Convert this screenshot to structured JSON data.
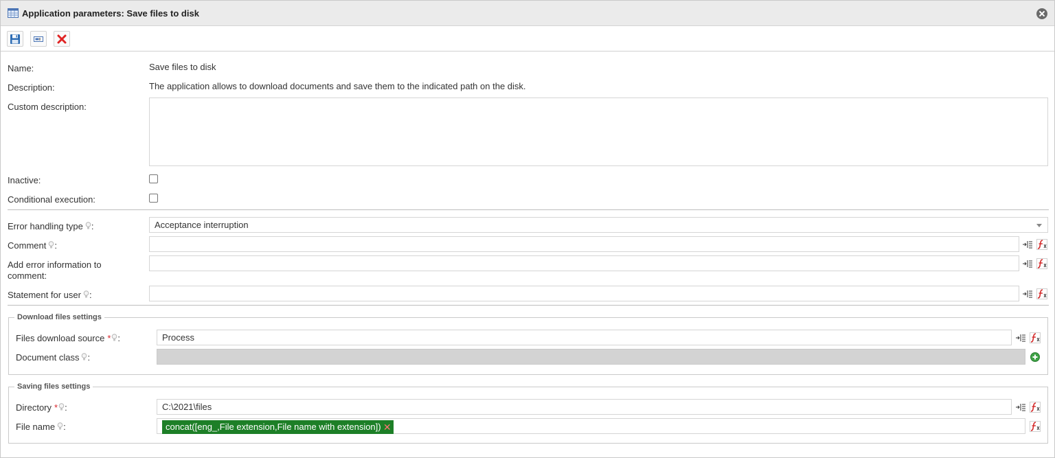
{
  "window": {
    "title": "Application parameters: Save files to disk"
  },
  "icons": {
    "title": "table-icon",
    "close": "close-circle-icon",
    "save": "floppy-disk-icon",
    "form": "form-field-icon",
    "delete": "red-x-icon",
    "hint": "lightbulb-icon",
    "variable": "insert-variable-icon",
    "function": "function-icon",
    "add": "green-plus-circle-icon"
  },
  "colors": {
    "tag_bg": "#1d7f27",
    "tag_x": "#ff7474",
    "required": "#d8262c",
    "delete": "#e02424",
    "disabled_bg": "#d3d3d3"
  },
  "form": {
    "name_label": "Name:",
    "name_value": "Save files to disk",
    "description_label": "Description:",
    "description_value": "The application allows to download documents and save them to the indicated path on the disk.",
    "custom_description_label": "Custom description:",
    "custom_description_value": "",
    "inactive_label": "Inactive:",
    "conditional_label": "Conditional execution:",
    "error_type_label": "Error handling type",
    "error_type_value": "Acceptance interruption",
    "comment_label": "Comment",
    "comment_value": "",
    "add_error_label": "Add error information to comment:",
    "add_error_value": "",
    "statement_label": "Statement for user",
    "statement_value": "",
    "colon": ":"
  },
  "download": {
    "legend": "Download files settings",
    "source_label": "Files download source",
    "source_value": "Process",
    "doc_class_label": "Document class",
    "doc_class_value": "",
    "required_mark": "*"
  },
  "saving": {
    "legend": "Saving files settings",
    "directory_label": "Directory",
    "directory_value": "C:\\2021\\files",
    "filename_label": "File name",
    "filename_tag": "concat([eng_,File extension,File name with extension])",
    "tag_remove": "✕",
    "required_mark": "*"
  }
}
